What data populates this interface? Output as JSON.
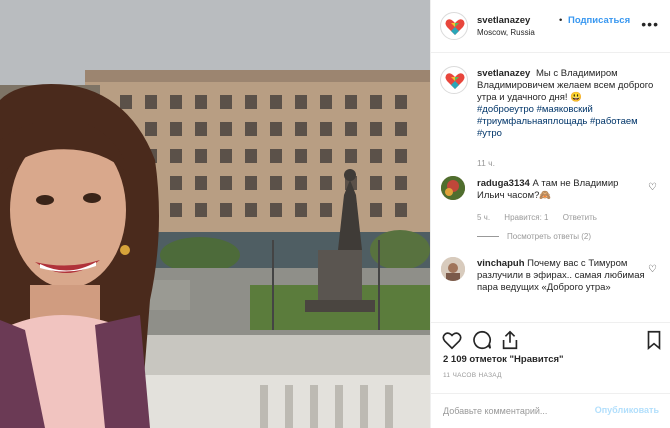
{
  "post": {
    "username": "svetlanazey",
    "separator": "•",
    "follow_label": "Подписаться",
    "location": "Moscow, Russia",
    "more_icon": "more-horizontal-icon"
  },
  "caption": {
    "username": "svetlanazey",
    "text": "Мы с Владимиром Владимировичем желаем всем доброго утра и удачного дня! 😃",
    "hashtags": [
      "#доброеутро",
      "#маяковский",
      "#триумфальнаяплощадь",
      "#работаем",
      "#утро"
    ],
    "time": "11 ч."
  },
  "comments": [
    {
      "username": "raduga3134",
      "text": "А там не Владимир Ильич часом?🙈",
      "time": "5 ч.",
      "likes_label": "Нравится: 1",
      "reply_label": "Ответить",
      "view_replies": "Посмотреть ответы (2)"
    },
    {
      "username": "vinchapuh",
      "text": "Почему вас с Тимуром разлучили в эфирах.. самая любимая пара ведущих «Доброго утра»"
    }
  ],
  "actions": {
    "likes": "2 109 отметок \"Нравится\"",
    "posted_ago": "11 ЧАСОВ НАЗАД"
  },
  "comment_box": {
    "placeholder": "Добавьте комментарий...",
    "publish_label": "Опубликовать"
  },
  "colors": {
    "accent": "#3897f0",
    "hashtag": "#003569",
    "muted": "#999999",
    "publish_disabled": "#b2dffc"
  }
}
